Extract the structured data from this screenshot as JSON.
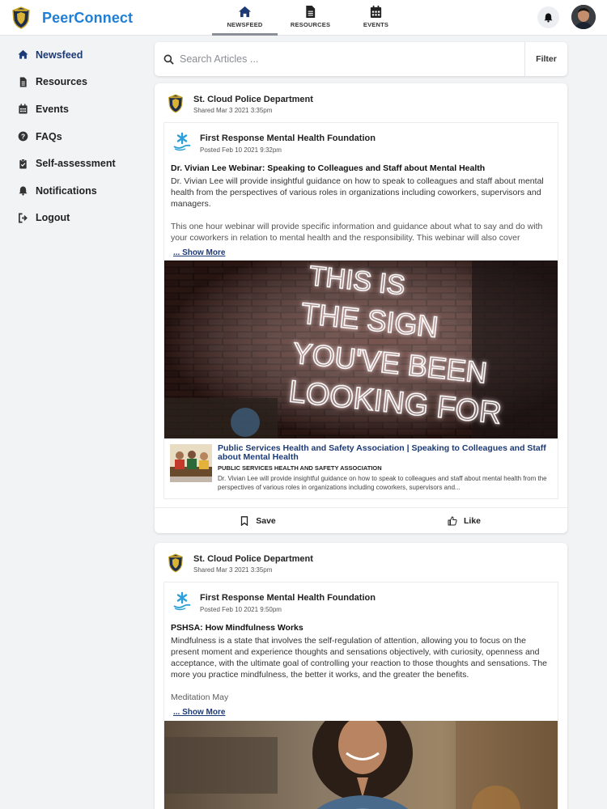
{
  "header": {
    "brand": "PeerConnect",
    "nav": [
      {
        "label": "NEWSFEED",
        "icon": "home-icon",
        "active": true
      },
      {
        "label": "RESOURCES",
        "icon": "document-icon",
        "active": false
      },
      {
        "label": "EVENTS",
        "icon": "calendar-icon",
        "active": false
      }
    ]
  },
  "sidebar": {
    "items": [
      {
        "label": "Newsfeed",
        "icon": "home-icon",
        "active": true
      },
      {
        "label": "Resources",
        "icon": "document-icon",
        "active": false
      },
      {
        "label": "Events",
        "icon": "calendar-icon",
        "active": false
      },
      {
        "label": "FAQs",
        "icon": "question-circle-icon",
        "active": false
      },
      {
        "label": "Self-assessment",
        "icon": "clipboard-icon",
        "active": false
      },
      {
        "label": "Notifications",
        "icon": "bell-icon",
        "active": false
      },
      {
        "label": "Logout",
        "icon": "logout-icon",
        "active": false
      }
    ]
  },
  "search": {
    "placeholder": "Search Articles ...",
    "filter_label": "Filter"
  },
  "posts": [
    {
      "author": "St. Cloud Police Department",
      "shared": "Shared Mar 3 2021 3:35pm",
      "org": "First Response Mental Health Foundation",
      "posted": "Posted Feb 10 2021 9:32pm",
      "title": "Dr. Vivian Lee Webinar: Speaking to Colleagues and Staff about Mental Health",
      "body": "Dr. Vivian Lee will provide insightful guidance on how to speak to colleagues and staff about mental health from the perspectives of various roles in organizations including coworkers, supervisors and managers.",
      "body2": "This one hour webinar will provide specific information and guidance about what to say and do with your coworkers in relation to mental health and the responsibility. This webinar will also cover",
      "show_more": "... Show More",
      "hero_text": [
        "THIS IS",
        "THE SIGN",
        "YOU'VE BEEN",
        "LOOKING FOR"
      ],
      "link_title": "Public Services Health and Safety Association | Speaking to Colleagues and Staff about Mental Health",
      "link_source": "PUBLIC SERVICES HEALTH AND SAFETY ASSOCIATION",
      "link_desc": "Dr. Vivian Lee will provide insightful guidance on how to speak to colleagues and staff about mental health from the perspectives of various roles in organizations including coworkers, supervisors and...",
      "save_label": "Save",
      "like_label": "Like"
    },
    {
      "author": "St. Cloud Police Department",
      "shared": "Shared Mar 3 2021 3:35pm",
      "org": "First Response Mental Health Foundation",
      "posted": "Posted Feb 10 2021 9:50pm",
      "title": "PSHSA: How Mindfulness Works",
      "body": "Mindfulness is a state that involves the self-regulation of attention, allowing you to focus on the present moment and experience thoughts and sensations objectively, with curiosity, openness and acceptance, with the ultimate goal of controlling your reaction to those thoughts and sensations. The more you practice mindfulness, the better it works, and the greater the benefits.",
      "body2": "Meditation May",
      "show_more": "... Show More"
    }
  ],
  "colors": {
    "brand": "#1f7fd6",
    "nav_active": "#1c3a75",
    "link": "#1c3a75"
  }
}
